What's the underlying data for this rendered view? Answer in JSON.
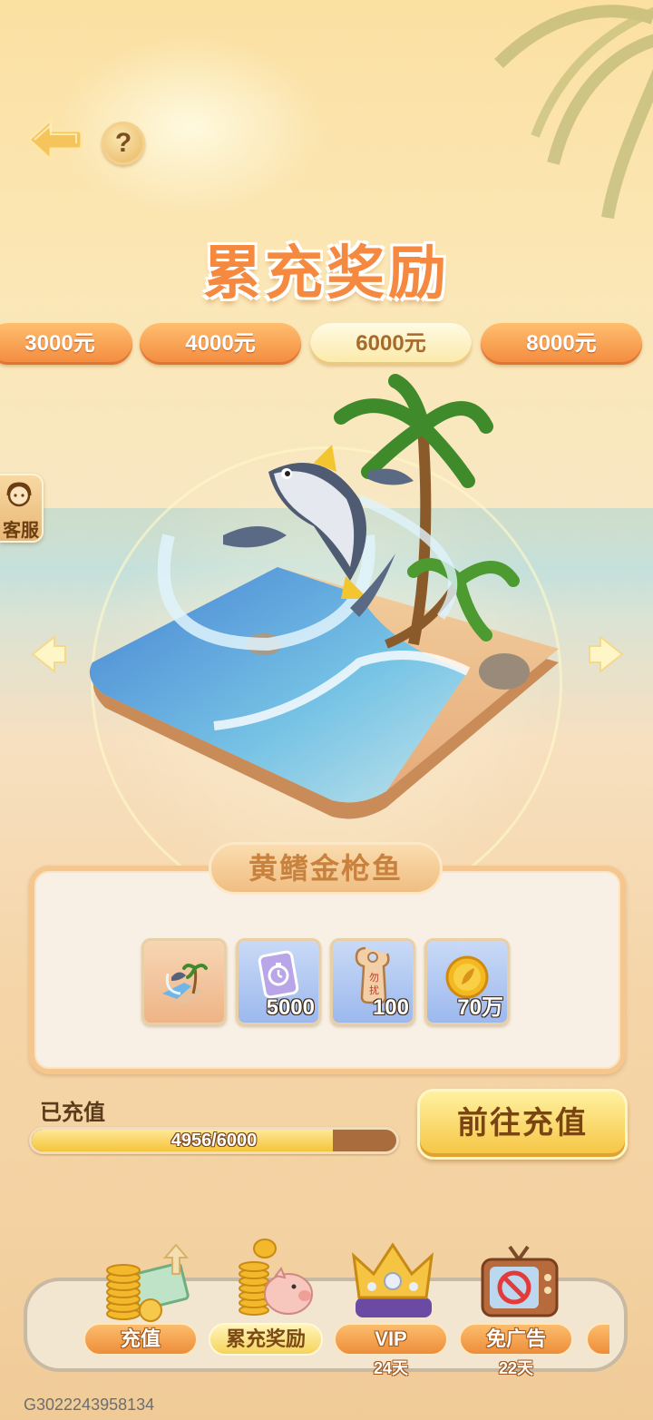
{
  "header": {
    "title": "累充奖励",
    "back_icon": "back-arrow-icon",
    "help_label": "?"
  },
  "tiers": [
    {
      "label": "3000元",
      "active": false
    },
    {
      "label": "4000元",
      "active": false
    },
    {
      "label": "6000元",
      "active": true
    },
    {
      "label": "8000元",
      "active": false
    }
  ],
  "support": {
    "label": "客服",
    "icon": "headset-icon"
  },
  "reward": {
    "name": "黄鳍金枪鱼",
    "items": [
      {
        "icon": "tuna-island-icon",
        "count": ""
      },
      {
        "icon": "stopwatch-card-icon",
        "count": "5000"
      },
      {
        "icon": "do-not-disturb-tag-icon",
        "count": "100"
      },
      {
        "icon": "gold-coin-icon",
        "count": "70万"
      }
    ]
  },
  "progress": {
    "label": "已充值",
    "current": 4956,
    "target": 6000,
    "text": "4956/6000"
  },
  "recharge_button": "前往充值",
  "nav": [
    {
      "label": "充值",
      "sub": "",
      "icon": "coins-money-icon",
      "active": false
    },
    {
      "label": "累充奖励",
      "sub": "",
      "icon": "piggy-bank-icon",
      "active": true
    },
    {
      "label": "VIP",
      "sub": "24天",
      "icon": "crown-icon",
      "active": false
    },
    {
      "label": "免广告",
      "sub": "22天",
      "icon": "no-ads-tv-icon",
      "active": false
    }
  ],
  "user_id": "G3022243958134",
  "colors": {
    "accent_orange": "#f38a3e",
    "active_tab": "#fbe9a6",
    "progress_fill": "#f5c43a",
    "progress_track": "#a96c3c"
  }
}
